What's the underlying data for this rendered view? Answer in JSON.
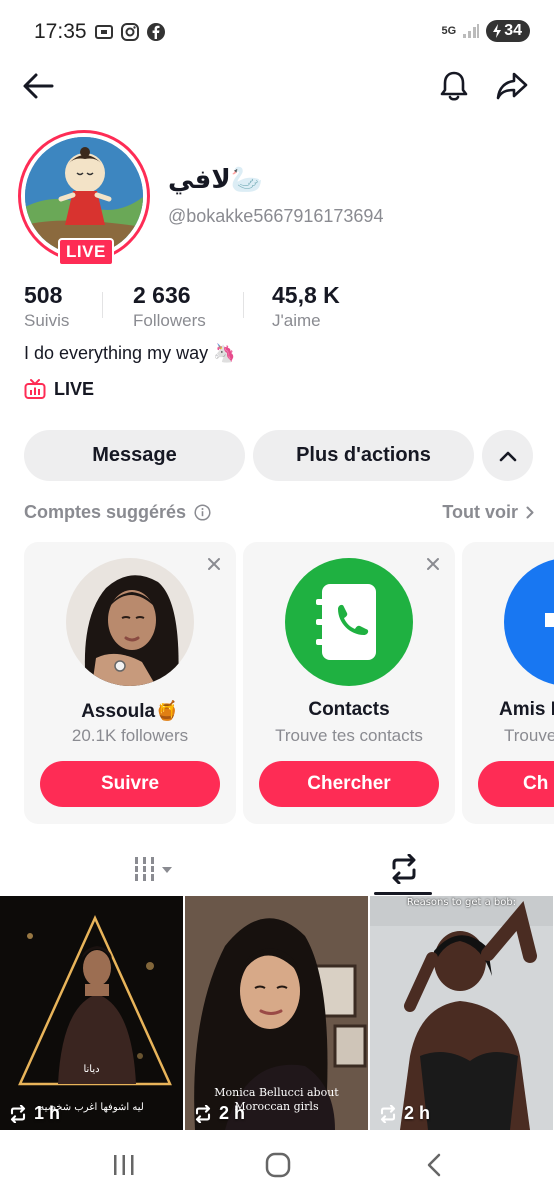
{
  "status_bar": {
    "time": "17:35",
    "network": "5G",
    "battery": "34"
  },
  "profile": {
    "display_name": "لافي🦢",
    "username": "@bokakke5667916173694",
    "live_badge": "LIVE",
    "bio": "I do everything my way 🦄",
    "live_link": "LIVE"
  },
  "stats": [
    {
      "value": "508",
      "label": "Suivis"
    },
    {
      "value": "2 636",
      "label": "Followers"
    },
    {
      "value": "45,8 K",
      "label": "J'aime"
    }
  ],
  "actions": {
    "message": "Message",
    "more_actions": "Plus d'actions"
  },
  "suggestions": {
    "title": "Comptes suggérés",
    "see_all": "Tout voir",
    "cards": [
      {
        "name": "Assoula🍯",
        "sub": "20.1K followers",
        "button": "Suivre"
      },
      {
        "name": "Contacts",
        "sub": "Trouve tes contacts",
        "button": "Chercher"
      },
      {
        "name": "Amis F",
        "sub": "Trouve",
        "button": "Ch"
      }
    ]
  },
  "videos": [
    {
      "time": "1 h",
      "caption_top": "ديانا",
      "caption_bottom": "ليه اشوفها اغرب شخصيه"
    },
    {
      "time": "2 h",
      "caption_top": "Monica Bellucci about",
      "caption_bottom": "Moroccan girls"
    },
    {
      "time": "2 h",
      "caption_top": "Reasons to get a bob:",
      "caption_bottom": ""
    }
  ],
  "colors": {
    "accent": "#fe2c55",
    "text": "#161823",
    "muted": "#8a8b91",
    "pill_bg": "#eeeeef",
    "card_bg": "#f6f6f6",
    "contacts_green": "#1fb141",
    "amis_blue": "#1877f2"
  }
}
